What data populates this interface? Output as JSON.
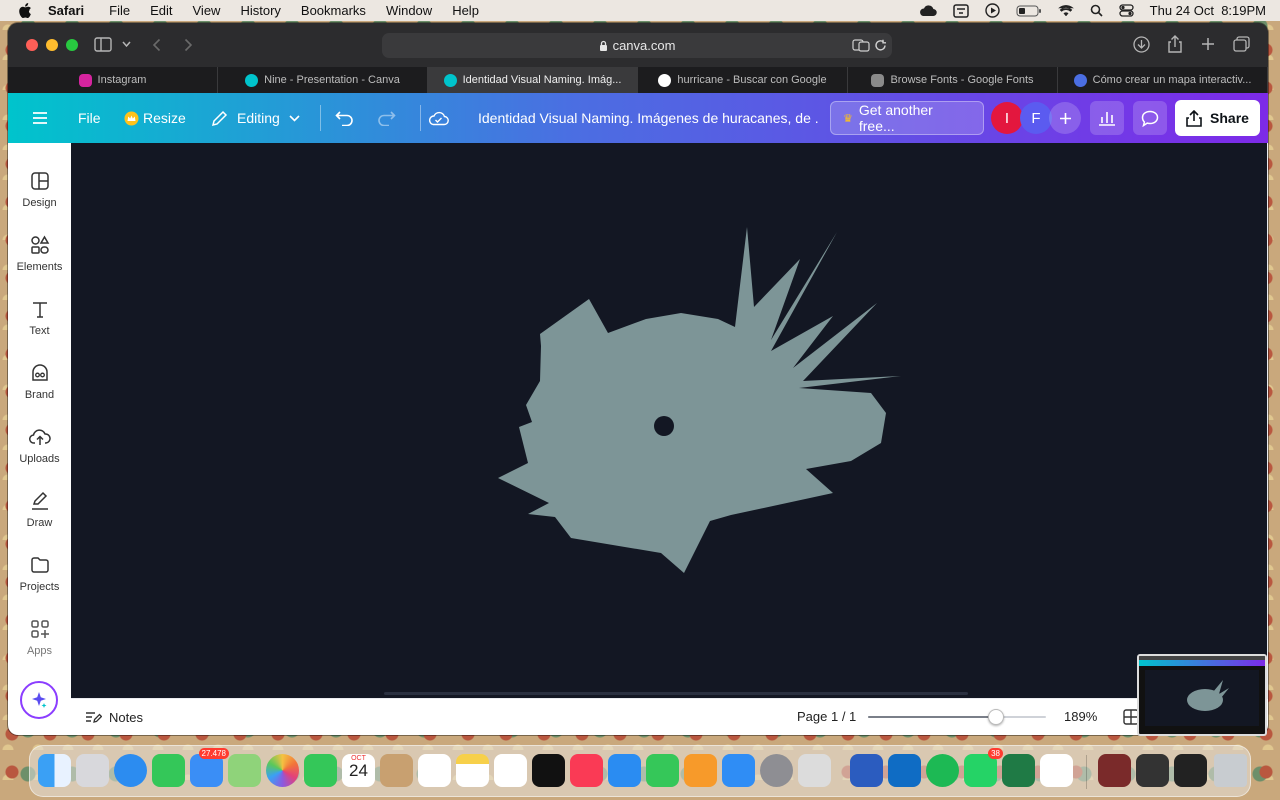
{
  "menubar": {
    "app": "Safari",
    "items": [
      "File",
      "Edit",
      "View",
      "History",
      "Bookmarks",
      "Window",
      "Help"
    ],
    "datetime": "Thu 24 Oct  8:19PM"
  },
  "browser": {
    "address": "canva.com",
    "tabs": [
      {
        "label": "Instagram",
        "color": "#d6249f"
      },
      {
        "label": "Nine - Presentation - Canva",
        "color": "#00c4cc"
      },
      {
        "label": "Identidad Visual Naming. Imág...",
        "color": "#00c4cc",
        "active": true
      },
      {
        "label": "hurricane - Buscar con Google",
        "color": "#ffffff"
      },
      {
        "label": "Browse Fonts - Google Fonts",
        "color": "#8a8a8a"
      },
      {
        "label": "Cómo crear un mapa interactiv...",
        "color": "#4b6ee2"
      }
    ]
  },
  "canva": {
    "file_label": "File",
    "resize_label": "Resize",
    "editing_label": "Editing",
    "doc_title": "Identidad Visual Naming. Imágenes de huracanes, de ...",
    "upgrade_label": "Get another free...",
    "avatars": [
      {
        "initial": "I",
        "color": "#e3173e"
      },
      {
        "initial": "F",
        "color": "#5b5bf0"
      }
    ],
    "share_label": "Share",
    "rail": [
      "Design",
      "Elements",
      "Text",
      "Brand",
      "Uploads",
      "Draw",
      "Projects",
      "Apps"
    ],
    "notes_label": "Notes",
    "page_label": "Page 1 / 1",
    "zoom_label": "189%",
    "zoom_level": 0.72,
    "shape_color": "#7d9597",
    "canvas_bg": "#131723"
  },
  "dock": {
    "mail_badge": "27.478",
    "calendar_month": "OCT",
    "calendar_day": "24",
    "whatsapp_badge": "38",
    "apps": [
      "Finder",
      "Launchpad",
      "Safari",
      "Messages",
      "Mail",
      "Maps",
      "Photos",
      "FaceTime",
      "Calendar",
      "Contacts",
      "Reminders",
      "Notes",
      "Freeform",
      "TV",
      "Music",
      "Keynote",
      "Numbers",
      "Pages",
      "App Store",
      "System Settings",
      "Preview",
      "Word",
      "Outlook",
      "Spotify",
      "WhatsApp",
      "Excel",
      "VS Code",
      "Photo Booth",
      "Screenshot",
      "Activity",
      "Trash"
    ]
  }
}
